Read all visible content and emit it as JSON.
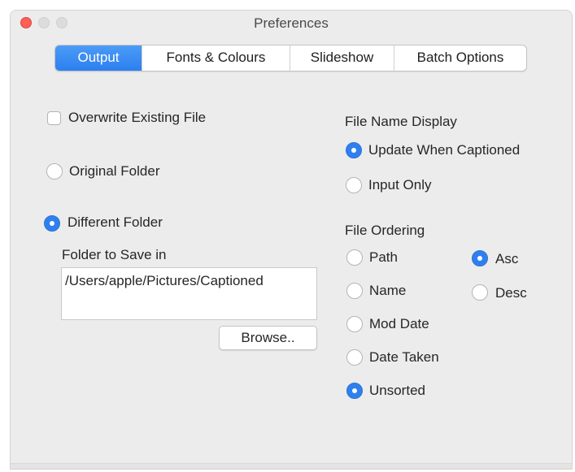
{
  "window": {
    "title": "Preferences"
  },
  "tabs": [
    {
      "label": "Output",
      "active": true
    },
    {
      "label": "Fonts & Colours",
      "active": false
    },
    {
      "label": "Slideshow",
      "active": false
    },
    {
      "label": "Batch Options",
      "active": false
    }
  ],
  "output": {
    "overwrite_label": "Overwrite Existing File",
    "overwrite_checked": false,
    "original_folder_label": "Original Folder",
    "different_folder_label": "Different Folder",
    "selected_folder_option": "Different Folder",
    "folder_to_save_label": "Folder to Save in",
    "folder_path": "/Users/apple/Pictures/Captioned",
    "browse_label": "Browse.."
  },
  "file_name_display": {
    "heading": "File Name Display",
    "update_label": "Update When Captioned",
    "input_only_label": "Input Only",
    "selected": "Update When Captioned"
  },
  "file_ordering": {
    "heading": "File Ordering",
    "path_label": "Path",
    "name_label": "Name",
    "mod_date_label": "Mod Date",
    "date_taken_label": "Date Taken",
    "unsorted_label": "Unsorted",
    "selected_field": "Unsorted",
    "asc_label": "Asc",
    "desc_label": "Desc",
    "selected_direction": "Asc"
  },
  "colors": {
    "accent": "#2f80ee",
    "close": "#fe5f57"
  }
}
